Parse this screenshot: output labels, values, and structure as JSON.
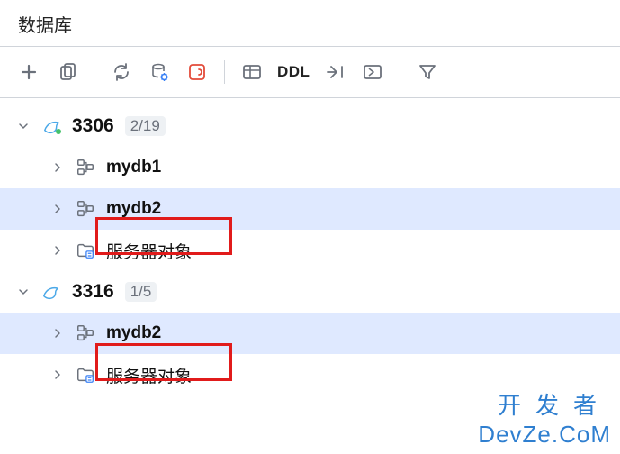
{
  "panel": {
    "title": "数据库"
  },
  "toolbar": {
    "new_label": "新建",
    "duplicate_label": "复制",
    "refresh_label": "刷新",
    "settings_label": "数据源属性",
    "stop_label": "停止",
    "table_label": "表视图",
    "ddl_label": "DDL",
    "jump_label": "跳转",
    "console_label": "查询控制台",
    "filter_label": "过滤"
  },
  "tree": {
    "connections": [
      {
        "name": "3306",
        "summary": "2/19",
        "expanded": true,
        "children": [
          {
            "type": "db",
            "name": "mydb1",
            "highlighted": false,
            "selected": false
          },
          {
            "type": "db",
            "name": "mydb2",
            "highlighted": true,
            "selected": true
          },
          {
            "type": "server",
            "name": "服务器对象"
          }
        ]
      },
      {
        "name": "3316",
        "summary": "1/5",
        "expanded": true,
        "children": [
          {
            "type": "db",
            "name": "mydb2",
            "highlighted": true,
            "selected": true
          },
          {
            "type": "server",
            "name": "服务器对象"
          }
        ]
      }
    ]
  },
  "watermark": {
    "line1": "开发者",
    "line2": "DevZe.CoM"
  }
}
